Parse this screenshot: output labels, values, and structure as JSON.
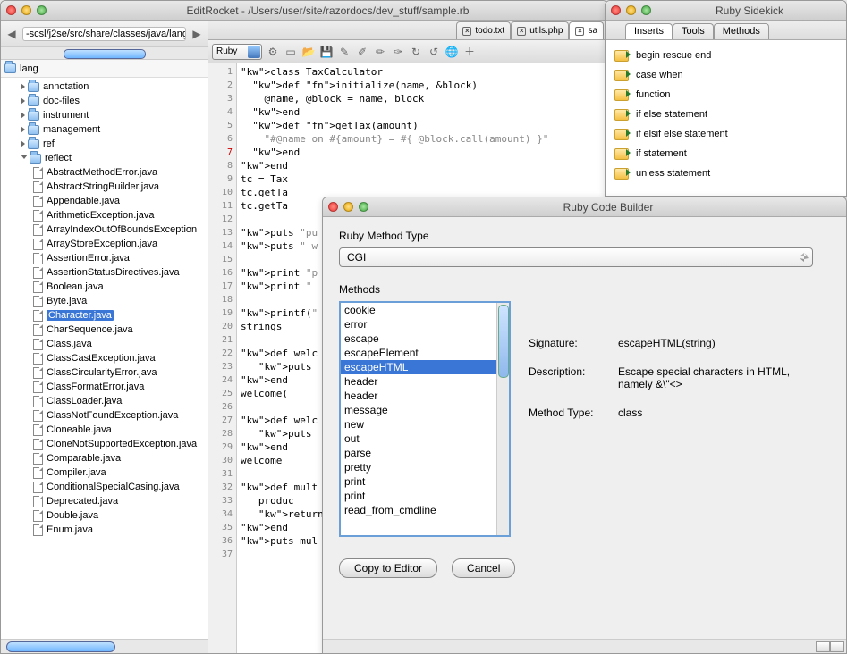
{
  "main_window": {
    "title": "EditRocket - /Users/user/site/razordocs/dev_stuff/sample.rb",
    "path_field": "-scsl/j2se/src/share/classes/java/lang",
    "root_folder": "lang",
    "language_selector": "Ruby",
    "tabs": [
      {
        "label": "todo.txt",
        "active": false
      },
      {
        "label": "utils.php",
        "active": false
      },
      {
        "label": "sa",
        "active": true
      }
    ],
    "tree_folders": [
      {
        "label": "annotation"
      },
      {
        "label": "doc-files"
      },
      {
        "label": "instrument"
      },
      {
        "label": "management"
      },
      {
        "label": "ref"
      },
      {
        "label": "reflect",
        "open": true
      }
    ],
    "tree_files": [
      "AbstractMethodError.java",
      "AbstractStringBuilder.java",
      "Appendable.java",
      "ArithmeticException.java",
      "ArrayIndexOutOfBoundsException",
      "ArrayStoreException.java",
      "AssertionError.java",
      "AssertionStatusDirectives.java",
      "Boolean.java",
      "Byte.java",
      "Character.java",
      "CharSequence.java",
      "Class.java",
      "ClassCastException.java",
      "ClassCircularityError.java",
      "ClassFormatError.java",
      "ClassLoader.java",
      "ClassNotFoundException.java",
      "Cloneable.java",
      "CloneNotSupportedException.java",
      "Comparable.java",
      "Compiler.java",
      "ConditionalSpecialCasing.java",
      "Deprecated.java",
      "Double.java",
      "Enum.java"
    ],
    "selected_file_index": 10,
    "code_lines": [
      "class TaxCalculator",
      "  def initialize(name, &block)",
      "    @name, @block = name, block",
      "  end",
      "  def getTax(amount)",
      "    \"#@name on #{amount} = #{ @block.call(amount) }\"",
      "  end",
      "end",
      "tc = Tax",
      "tc.getTa",
      "tc.getTa",
      "",
      "puts \"pu",
      "puts \" w",
      "",
      "print \"p",
      "print \" ",
      "",
      "printf(\"",
      "strings ",
      "",
      "def welc",
      "   puts ",
      "end",
      "welcome(",
      "",
      "def welc",
      "   puts ",
      "end",
      "welcome ",
      "",
      "def mult",
      "   produc",
      "   return",
      "end",
      "puts mul",
      ""
    ]
  },
  "sidekick": {
    "title": "Ruby Sidekick",
    "tabs": [
      "Inserts",
      "Tools",
      "Methods"
    ],
    "active_tab": 0,
    "items": [
      "begin rescue end",
      "case when",
      "function",
      "if else statement",
      "if elsif else statement",
      "if statement",
      "unless statement"
    ]
  },
  "builder": {
    "title": "Ruby Code Builder",
    "type_label": "Ruby Method Type",
    "type_value": "CGI",
    "methods_label": "Methods",
    "methods": [
      "cookie",
      "error",
      "escape",
      "escapeElement",
      "escapeHTML",
      "header",
      "header",
      "message",
      "new",
      "out",
      "parse",
      "pretty",
      "print",
      "print",
      "read_from_cmdline"
    ],
    "selected_method_index": 4,
    "signature_label": "Signature:",
    "signature_value": "escapeHTML(string)",
    "description_label": "Description:",
    "description_value": "Escape special characters in HTML, namely &\\\"<>",
    "method_type_label": "Method Type:",
    "method_type_value": "class",
    "copy_btn": "Copy to Editor",
    "cancel_btn": "Cancel"
  }
}
